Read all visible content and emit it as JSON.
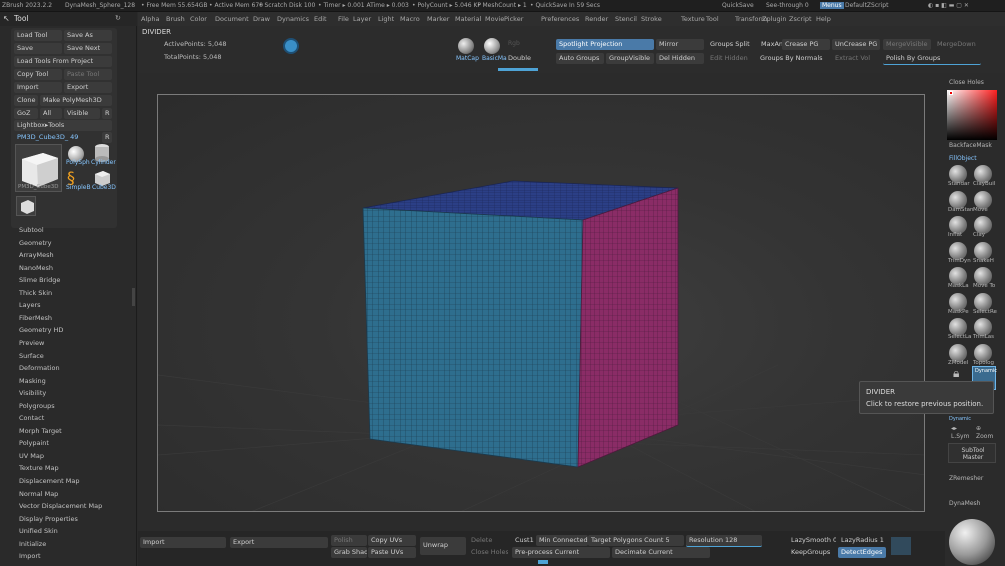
{
  "title": {
    "app": "ZBrush 2023.2.2",
    "doc": "DynaMesh_Sphere_128",
    "free_mem": "• Free Mem 55.654GB",
    "active_mem": "• Active Mem 670",
    "scratch": "• Scratch Disk 100",
    "timer": "• Timer ▸ 0.001 ATime ▸ 0.003",
    "polycount": "• PolyCount ▸ 5.046 KP",
    "meshcount": "• MeshCount ▸ 1",
    "quicksave_in": "• QuickSave In 59 Secs",
    "quicksave": "QuickSave",
    "see_through": "See-through 0",
    "menus": "Menus",
    "default_zscript": "DefaultZScript"
  },
  "menu": [
    "Alpha",
    "Brush",
    "Color",
    "Document",
    "Draw",
    "Dynamics",
    "Edit",
    "File",
    "Layer",
    "Light",
    "Macro",
    "Marker",
    "Material",
    "Movie",
    "Picker",
    "Preferences",
    "Render",
    "Stencil",
    "Stroke",
    "Texture",
    "Tool",
    "Transform",
    "Zplugin",
    "Zscript",
    "Help"
  ],
  "tool_panel": {
    "header": "Tool",
    "load_tool": "Load Tool",
    "save_as": "Save As",
    "save": "Save",
    "save_next": "Save Next",
    "load_tools_from_project": "Load Tools From Project",
    "copy_tool": "Copy Tool",
    "paste_tool": "Paste Tool",
    "import": "Import",
    "export": "Export",
    "clone": "Clone",
    "make_polymesh": "Make PolyMesh3D",
    "goz": "GoZ",
    "all": "All",
    "visible": "Visible",
    "r": "R",
    "lightbox_tools": "Lightbox▸Tools",
    "current_tool": "PM3D_Cube3D_ 49",
    "current_tool_r": "R",
    "thumb_cube_label": "PM3D_Cube3D",
    "thumb_polysphere": "PolySph",
    "thumb_cylinder": "Cylinder",
    "thumb_simpleb": "SimpleB",
    "thumb_cube3d": "Cube3D",
    "thumb_small": "PM3D_"
  },
  "subpalettes": [
    "Subtool",
    "Geometry",
    "ArrayMesh",
    "NanoMesh",
    "Slime Bridge",
    "Thick Skin",
    "Layers",
    "FiberMesh",
    "Geometry HD",
    "Preview",
    "Surface",
    "Deformation",
    "Masking",
    "Visibility",
    "Polygroups",
    "Contact",
    "Morph Target",
    "Polypaint",
    "UV Map",
    "Texture Map",
    "Displacement Map",
    "Normal Map",
    "Vector Displacement Map",
    "Display Properties",
    "Unified Skin",
    "Initialize",
    "Import"
  ],
  "shelf": {
    "divider": "DIVIDER",
    "active_points": "ActivePoints: 5,048",
    "total_points": "TotalPoints: 5,048",
    "matcap": "MatCap",
    "basicmat": "BasicMa",
    "rgb": "Rgb",
    "double": "Double",
    "spotlight_projection": "Spotlight Projection",
    "mirror": "Mirror",
    "groups_split": "Groups Split",
    "maxangle": "MaxAn",
    "crease_pg": "Crease PG",
    "uncrease_pg": "UnCrease PG",
    "merge_visible": "MergeVisible",
    "merge_down": "MergeDown",
    "auto_groups": "Auto Groups",
    "group_visible": "GroupVisible",
    "del_hidden": "Del Hidden",
    "edit_hidden": "Edit Hidden",
    "groups_by_normals": "Groups By Normals",
    "extract_vol": "Extract Vol",
    "polish_by_groups": "Polish By Groups"
  },
  "right_shelf": {
    "close_holes": "Close Holes",
    "backface_mask": "BackfaceMask",
    "fill_object": "FillObject",
    "brushes": [
      "Standar",
      "ClayBuil",
      "DamStan",
      "Move",
      "Inflat",
      "Clay",
      "TrimDyn",
      "SnakeH",
      "MaskLa",
      "Move To",
      "MaskPe",
      "SelectRe",
      "SelectLa",
      "TrimLas",
      "ZModel",
      "Topolog"
    ],
    "dynamic": "Dynamic",
    "persp": "Persp",
    "lsym": "L.Sym",
    "zoom": "Zoom",
    "subtool_master": "SubTool Master",
    "zremesher": "ZRemesher",
    "dynamesh": "DynaMesh"
  },
  "bottom": {
    "import": "Import",
    "export": "Export",
    "polish": "Polish",
    "copy_uvs": "Copy UVs",
    "grab_shader": "Grab Shader",
    "paste_uvs": "Paste UVs",
    "unwrap": "Unwrap",
    "delete": "Delete",
    "close_holes": "Close Holes",
    "cust1": "Cust1",
    "min_connected": "Min Connected F",
    "target_polygons": "Target Polygons Count 5",
    "preprocess": "Pre-process Current",
    "decimate": "Decimate Current",
    "resolution": "Resolution 128",
    "lazysmooth": "LazySmooth 0",
    "lazyradius": "LazyRadius 1",
    "keepgroups": "KeepGroups",
    "detect_edges": "DetectEdges"
  },
  "tooltip": {
    "title": "DIVIDER",
    "text": "Click to restore previous position."
  },
  "colors": {
    "cube_front": "#2e6e8e",
    "cube_top": "#2b3f86",
    "cube_right": "#8a2c66",
    "accent": "#4ea3d6"
  }
}
